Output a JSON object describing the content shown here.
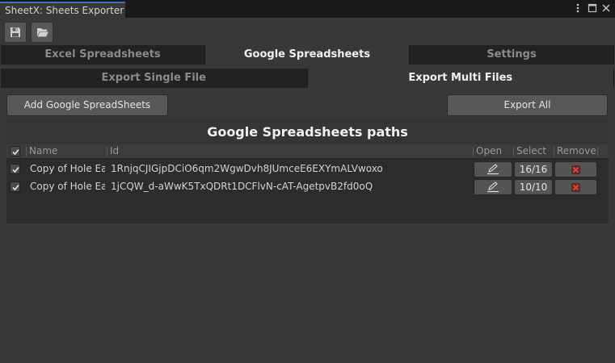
{
  "window": {
    "title": "SheetX: Sheets Exporter",
    "menu_icon": "kebab-menu-icon",
    "maximize_icon": "maximize-icon",
    "close_icon": "close-icon"
  },
  "toolbar": {
    "save_icon": "save-icon",
    "open_icon": "folder-open-icon"
  },
  "main_tabs": [
    {
      "label": "Excel Spreadsheets",
      "active": false
    },
    {
      "label": "Google Spreadsheets",
      "active": true
    },
    {
      "label": "Settings",
      "active": false
    }
  ],
  "sub_tabs": [
    {
      "label": "Export Single File",
      "active": false
    },
    {
      "label": "Export Multi Files",
      "active": true
    }
  ],
  "actions": {
    "add_label": "Add Google SpreadSheets",
    "export_all_label": "Export All"
  },
  "panel": {
    "title": "Google Spreadsheets paths",
    "headers": {
      "name": "Name",
      "id": "Id",
      "open": "Open",
      "select": "Select",
      "remove": "Remove"
    },
    "rows": [
      {
        "checked": true,
        "name": "Copy of Hole Eat",
        "id": "1RnjqCJIGjpDCiO6qm2WgwDvh8JUmceE6EXYmALVwoxo",
        "open_icon": "edit-icon",
        "select": "16/16",
        "remove_icon": "remove-icon"
      },
      {
        "checked": true,
        "name": "Copy of Hole Eat",
        "id": "1jCQW_d-aWwK5TxQDRt1DCFlvN-cAT-AgetpvB2fd0oQ",
        "open_icon": "edit-icon",
        "select": "10/10",
        "remove_icon": "remove-icon"
      }
    ]
  },
  "colors": {
    "accent": "#3a79bb",
    "remove": "#d23b2b"
  }
}
